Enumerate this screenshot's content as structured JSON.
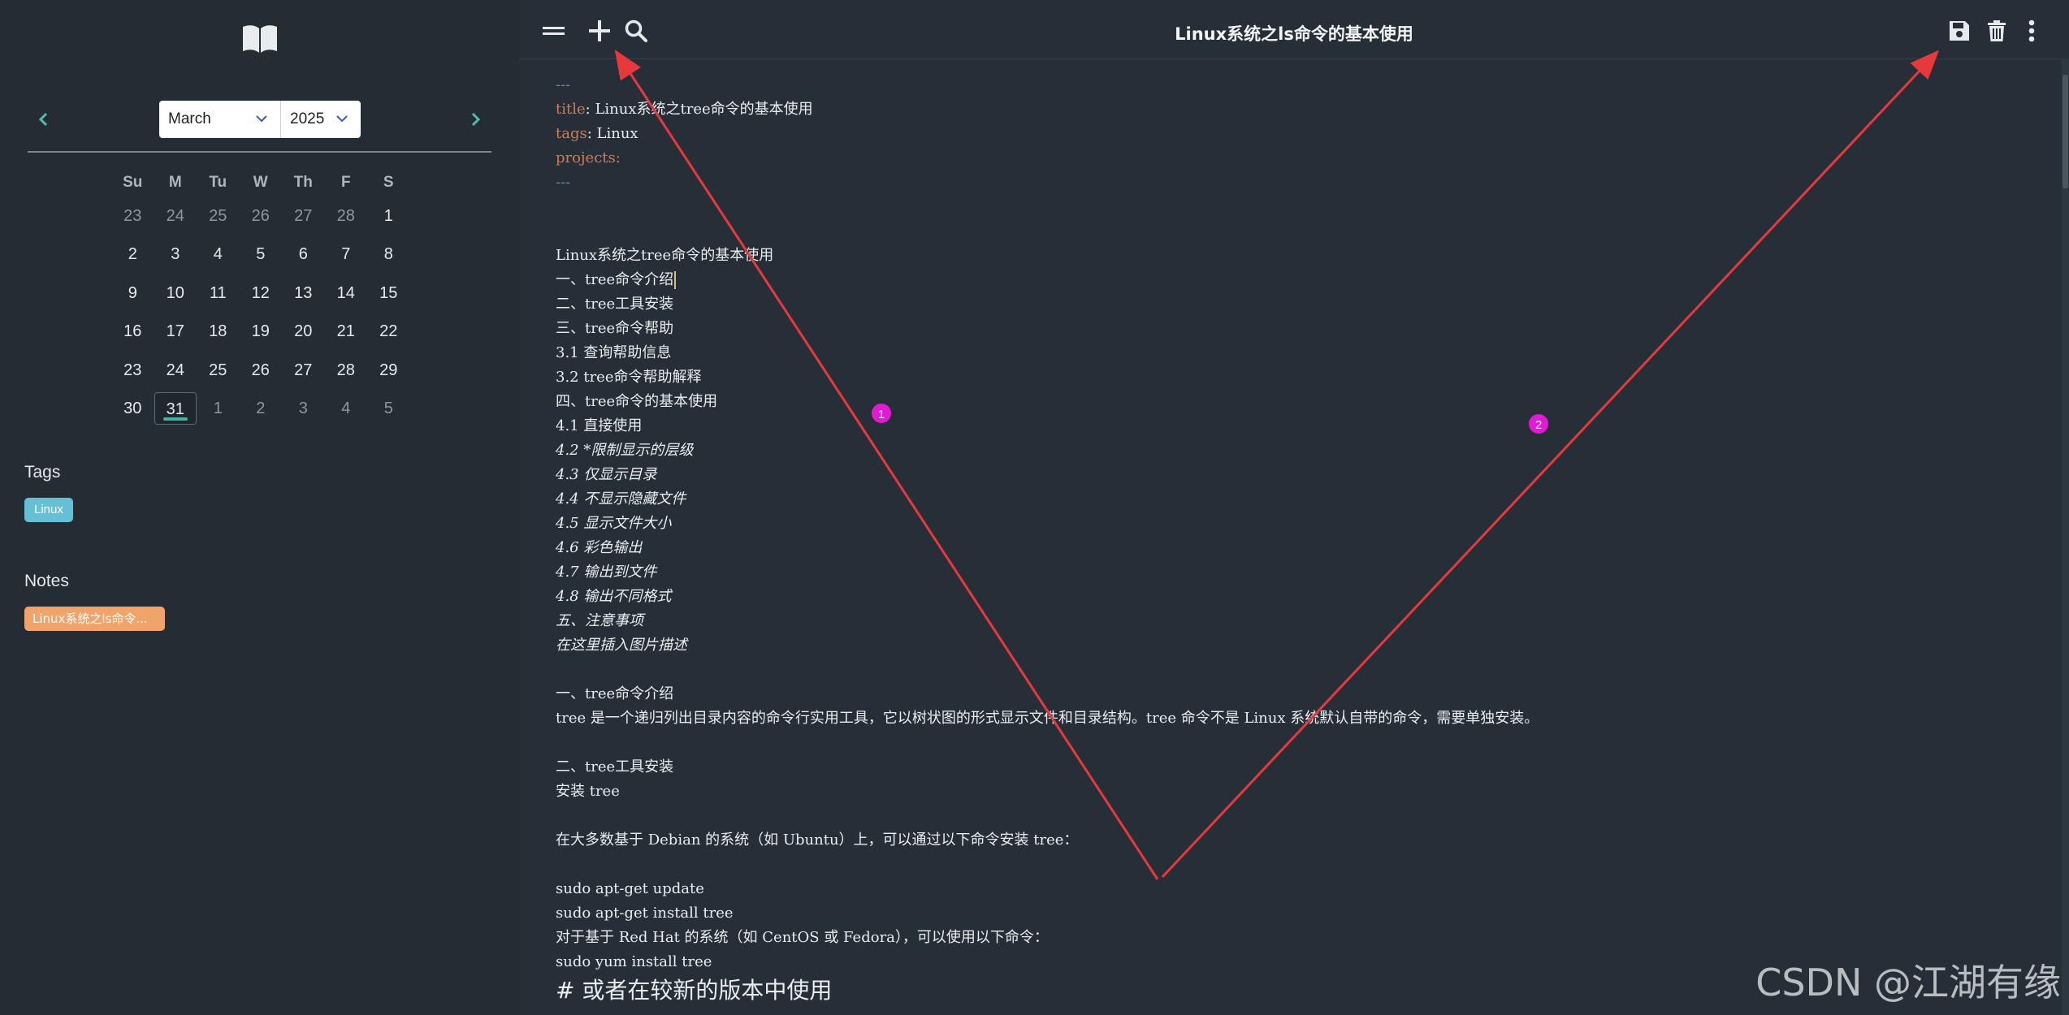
{
  "sidebar": {
    "calendar": {
      "month": "March",
      "year": "2025",
      "weekdays": [
        "Su",
        "M",
        "Tu",
        "W",
        "Th",
        "F",
        "S"
      ],
      "weeks": [
        [
          "23",
          "24",
          "25",
          "26",
          "27",
          "28",
          "1"
        ],
        [
          "2",
          "3",
          "4",
          "5",
          "6",
          "7",
          "8"
        ],
        [
          "9",
          "10",
          "11",
          "12",
          "13",
          "14",
          "15"
        ],
        [
          "16",
          "17",
          "18",
          "19",
          "20",
          "21",
          "22"
        ],
        [
          "23",
          "24",
          "25",
          "26",
          "27",
          "28",
          "29"
        ],
        [
          "30",
          "31",
          "1",
          "2",
          "3",
          "4",
          "5"
        ]
      ]
    },
    "tags_title": "Tags",
    "tags": [
      "Linux"
    ],
    "notes_title": "Notes",
    "notes": [
      "Linux系统之ls命令..."
    ]
  },
  "toolbar": {
    "title": "Linux系统之ls命令的基本使用"
  },
  "editor": {
    "frontmatter": {
      "dash": "---",
      "title_key": "title",
      "title_value": " Linux系统之tree命令的基本使用",
      "tags_key": "tags",
      "tags_value": " Linux",
      "projects_key": "projects"
    },
    "lines": [
      "Linux系统之tree命令的基本使用",
      "一、tree命令介绍",
      "二、tree工具安装",
      "三、tree命令帮助",
      "3.1 查询帮助信息",
      "3.2 tree命令帮助解释",
      "四、tree命令的基本使用",
      "4.1 直接使用",
      "4.2 *限制显示的层级",
      "4.3 仅显示目录",
      "4.4 不显示隐藏文件",
      "4.5 显示文件大小",
      "4.6 彩色输出",
      "4.7 输出到文件",
      "4.8 输出不同格式",
      "五、注意事项",
      "在这里插入图片描述",
      "",
      "一、tree命令介绍",
      "tree 是一个递归列出目录内容的命令行实用工具，它以树状图的形式显示文件和目录结构。tree 命令不是 Linux 系统默认自带的命令，需要单独安装。",
      "",
      "二、tree工具安装",
      "安装 tree",
      "",
      "在大多数基于 Debian 的系统（如 Ubuntu）上，可以通过以下命令安装 tree：",
      "",
      "sudo apt-get update",
      "sudo apt-get install tree",
      "对于基于 Red Hat 的系统（如 CentOS 或 Fedora），可以使用以下命令：",
      "sudo yum install tree"
    ],
    "heading_line": "# 或者在较新的版本中使用"
  },
  "annotations": {
    "labels": [
      "1",
      "2"
    ],
    "arrow_color": "#e8383b",
    "marker_color": "#e21ad6"
  },
  "watermark": "CSDN @江湖有缘"
}
